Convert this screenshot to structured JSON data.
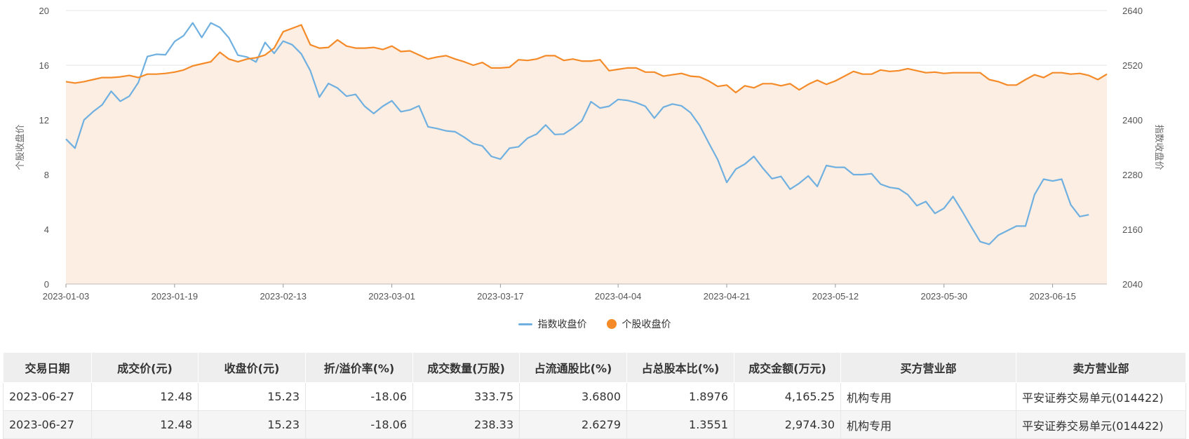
{
  "chart_data": {
    "type": "line",
    "ylabel_left": "个股收盘价",
    "ylabel_right": "指数收盘价",
    "ylim_left": [
      0,
      20
    ],
    "yticks_left": [
      0,
      4,
      8,
      12,
      16,
      20
    ],
    "ylim_right": [
      2040,
      2640
    ],
    "yticks_right": [
      2040,
      2160,
      2280,
      2400,
      2520,
      2640
    ],
    "x_tick_labels": [
      "2023-01-03",
      "2023-01-19",
      "2023-02-13",
      "2023-03-01",
      "2023-03-17",
      "2023-04-04",
      "2023-04-21",
      "2023-05-12",
      "2023-05-30",
      "2023-06-15"
    ],
    "grid": true,
    "legend_position": "bottom",
    "series": [
      {
        "name": "指数收盘价",
        "axis": "right",
        "color": "#6fb0e0",
        "values": [
          2358,
          2338,
          2400,
          2418,
          2433,
          2463,
          2441,
          2452,
          2482,
          2539,
          2544,
          2543,
          2572,
          2585,
          2613,
          2581,
          2613,
          2603,
          2580,
          2542,
          2538,
          2527,
          2570,
          2546,
          2573,
          2565,
          2545,
          2508,
          2450,
          2480,
          2470,
          2452,
          2456,
          2430,
          2414,
          2430,
          2442,
          2418,
          2422,
          2431,
          2385,
          2381,
          2376,
          2374,
          2362,
          2348,
          2343,
          2320,
          2314,
          2338,
          2341,
          2360,
          2369,
          2389,
          2368,
          2369,
          2382,
          2398,
          2440,
          2426,
          2430,
          2445,
          2443,
          2438,
          2430,
          2404,
          2428,
          2435,
          2431,
          2416,
          2388,
          2350,
          2313,
          2263,
          2292,
          2303,
          2320,
          2294,
          2271,
          2276,
          2248,
          2261,
          2277,
          2254,
          2300,
          2296,
          2296,
          2280,
          2280,
          2282,
          2259,
          2252,
          2249,
          2236,
          2212,
          2221,
          2195,
          2206,
          2232,
          2200,
          2166,
          2133,
          2127,
          2147,
          2157,
          2167,
          2167,
          2236,
          2270,
          2266,
          2270,
          2214,
          2188,
          2192
        ]
      },
      {
        "name": "个股收盘价",
        "axis": "left",
        "color": "#f58b28",
        "values": [
          14.8,
          14.7,
          14.8,
          14.95,
          15.1,
          15.1,
          15.15,
          15.25,
          15.1,
          15.35,
          15.35,
          15.4,
          15.5,
          15.65,
          15.95,
          16.1,
          16.25,
          16.95,
          16.45,
          16.25,
          16.45,
          16.55,
          16.75,
          17.25,
          18.45,
          18.7,
          18.95,
          17.5,
          17.25,
          17.3,
          17.85,
          17.4,
          17.25,
          17.25,
          17.3,
          17.15,
          17.4,
          17.0,
          17.05,
          16.75,
          16.45,
          16.6,
          16.7,
          16.45,
          16.25,
          16.0,
          16.2,
          15.8,
          15.8,
          15.85,
          16.4,
          16.35,
          16.45,
          16.7,
          16.7,
          16.35,
          16.45,
          16.3,
          16.3,
          16.4,
          15.6,
          15.7,
          15.8,
          15.8,
          15.5,
          15.5,
          15.2,
          15.3,
          15.4,
          15.2,
          15.15,
          14.85,
          14.45,
          14.55,
          14.0,
          14.5,
          14.35,
          14.65,
          14.65,
          14.5,
          14.65,
          14.2,
          14.6,
          14.9,
          14.6,
          14.85,
          15.2,
          15.55,
          15.35,
          15.35,
          15.65,
          15.55,
          15.6,
          15.75,
          15.6,
          15.45,
          15.5,
          15.4,
          15.45,
          15.45,
          15.45,
          15.45,
          14.95,
          14.8,
          14.55,
          14.55,
          14.95,
          15.3,
          15.1,
          15.45,
          15.45,
          15.35,
          15.4,
          15.25,
          14.95,
          15.35
        ]
      }
    ]
  },
  "table": {
    "headers": [
      "交易日期",
      "成交价(元)",
      "收盘价(元)",
      "折/溢价率(%)",
      "成交数量(万股)",
      "占流通股比(%)",
      "占总股本比(%)",
      "成交金额(万元)",
      "买方营业部",
      "卖方营业部"
    ],
    "rows": [
      [
        "2023-06-27",
        "12.48",
        "15.23",
        "-18.06",
        "333.75",
        "3.6800",
        "1.8976",
        "4,165.25",
        "机构专用",
        "平安证券交易单元(014422)"
      ],
      [
        "2023-06-27",
        "12.48",
        "15.23",
        "-18.06",
        "238.33",
        "2.6279",
        "1.3551",
        "2,974.30",
        "机构专用",
        "平安证券交易单元(014422)"
      ]
    ]
  },
  "colors": {
    "index_line": "#6fb0e0",
    "stock_line": "#f58b28",
    "area_fill": "#fdeee3",
    "grid": "#e6e6e6"
  }
}
